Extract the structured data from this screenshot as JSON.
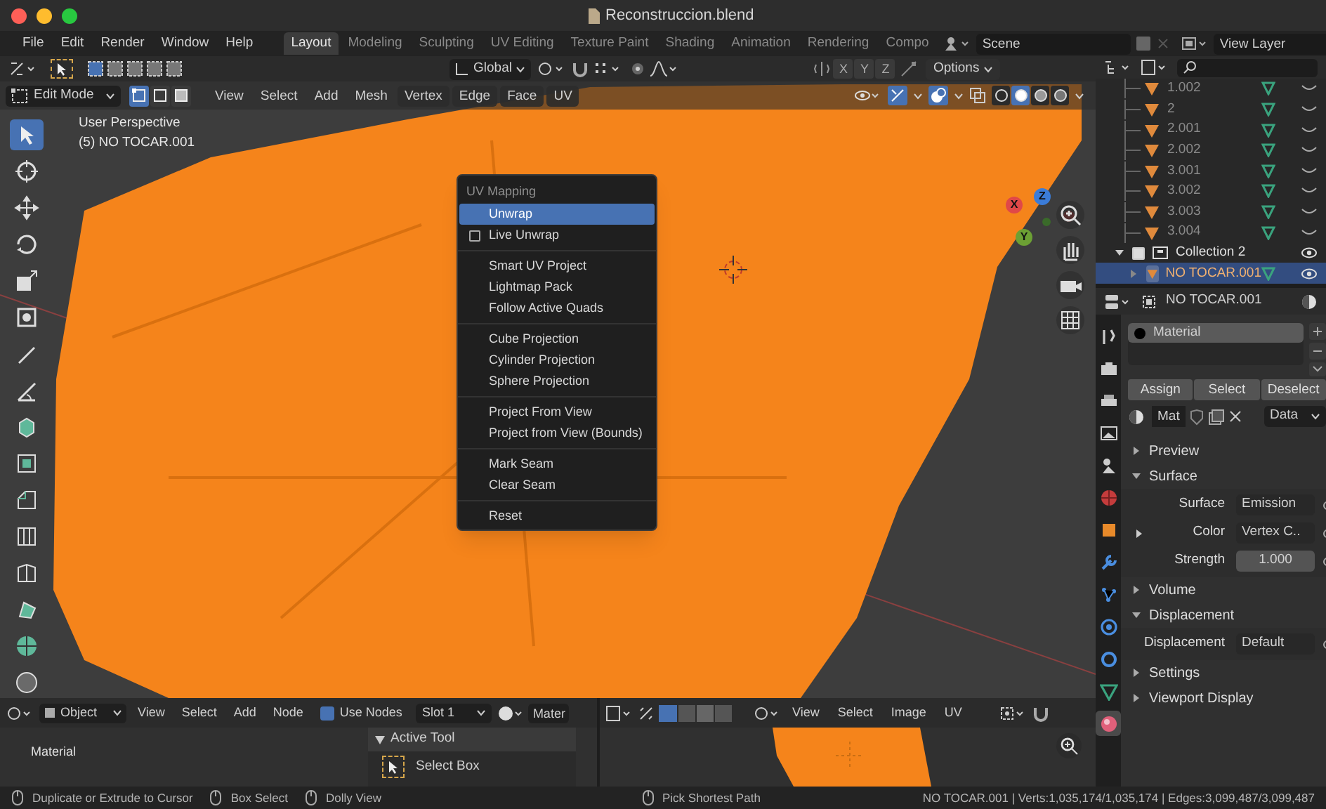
{
  "window": {
    "title": "Reconstruccion.blend"
  },
  "menu": [
    "File",
    "Edit",
    "Render",
    "Window",
    "Help"
  ],
  "workspaces": [
    {
      "label": "Layout",
      "selected": true
    },
    {
      "label": "Modeling",
      "selected": false
    },
    {
      "label": "Sculpting",
      "selected": false
    },
    {
      "label": "UV Editing",
      "selected": false
    },
    {
      "label": "Texture Paint",
      "selected": false
    },
    {
      "label": "Shading",
      "selected": false
    },
    {
      "label": "Animation",
      "selected": false
    },
    {
      "label": "Rendering",
      "selected": false
    },
    {
      "label": "Compo",
      "selected": false
    }
  ],
  "scene": "Scene",
  "view_layer": "View Layer",
  "tool_header": {
    "orientation": "Global",
    "axes": [
      "X",
      "Y",
      "Z"
    ],
    "options": "Options"
  },
  "mode_header": {
    "mode": "Edit Mode",
    "select_modes": [
      {
        "selected": true
      },
      {
        "selected": false
      },
      {
        "selected": false
      }
    ],
    "menus": [
      "View",
      "Select",
      "Add",
      "Mesh",
      "Vertex",
      "Edge",
      "Face",
      "UV"
    ],
    "shading": [
      {
        "selected": false
      },
      {
        "selected": true
      },
      {
        "selected": false
      },
      {
        "selected": false
      }
    ]
  },
  "toolbar": [
    {
      "selected": true
    },
    {
      "selected": false
    },
    {
      "selected": false
    },
    {
      "selected": false
    },
    {
      "selected": false
    },
    {
      "selected": false
    },
    {
      "selected": false
    },
    {
      "selected": false
    },
    {
      "selected": false
    },
    {
      "selected": false
    },
    {
      "selected": false
    },
    {
      "selected": false
    },
    {
      "selected": false
    },
    {
      "selected": false
    },
    {
      "selected": false
    },
    {
      "selected": false
    }
  ],
  "viewport": {
    "view_name": "User Perspective",
    "object": "(5) NO TOCAR.001",
    "gizmo_axes": [
      "X",
      "Z",
      "Y"
    ]
  },
  "uv_menu": {
    "title": "UV Mapping",
    "groups": [
      [
        {
          "label": "Unwrap",
          "kind": "item",
          "selected": true
        },
        {
          "label": "Live Unwrap",
          "kind": "checkbox",
          "checked": false,
          "selected": false
        }
      ],
      [
        {
          "label": "Smart UV Project",
          "kind": "item",
          "selected": false
        },
        {
          "label": "Lightmap Pack",
          "kind": "item",
          "selected": false
        },
        {
          "label": "Follow Active Quads",
          "kind": "item",
          "selected": false
        }
      ],
      [
        {
          "label": "Cube Projection",
          "kind": "item",
          "selected": false
        },
        {
          "label": "Cylinder Projection",
          "kind": "item",
          "selected": false
        },
        {
          "label": "Sphere Projection",
          "kind": "item",
          "selected": false
        }
      ],
      [
        {
          "label": "Project From View",
          "kind": "item",
          "selected": false
        },
        {
          "label": "Project from View (Bounds)",
          "kind": "item",
          "selected": false
        }
      ],
      [
        {
          "label": "Mark Seam",
          "kind": "item",
          "selected": false
        },
        {
          "label": "Clear Seam",
          "kind": "item",
          "selected": false
        }
      ],
      [
        {
          "label": "Reset",
          "kind": "item",
          "selected": false
        }
      ]
    ]
  },
  "outliner": {
    "items": [
      {
        "label": "1.002",
        "kind": "mesh",
        "visible": false,
        "selected": false
      },
      {
        "label": "2",
        "kind": "mesh",
        "visible": false,
        "selected": false
      },
      {
        "label": "2.001",
        "kind": "mesh",
        "visible": false,
        "selected": false
      },
      {
        "label": "2.002",
        "kind": "mesh",
        "visible": false,
        "selected": false
      },
      {
        "label": "3.001",
        "kind": "mesh",
        "visible": false,
        "selected": false
      },
      {
        "label": "3.002",
        "kind": "mesh",
        "visible": false,
        "selected": false
      },
      {
        "label": "3.003",
        "kind": "mesh",
        "visible": false,
        "selected": false
      },
      {
        "label": "3.004",
        "kind": "mesh",
        "visible": false,
        "selected": false
      },
      {
        "label": "Collection 2",
        "kind": "collection",
        "visible": true,
        "checked": true,
        "expanded": true,
        "selected": false,
        "children": [
          {
            "label": "NO TOCAR.001",
            "kind": "mesh",
            "visible": true,
            "selected": true
          }
        ]
      }
    ]
  },
  "properties": {
    "object": "NO TOCAR.001",
    "tabs": [
      {
        "selected": false
      },
      {
        "selected": false
      },
      {
        "selected": false
      },
      {
        "selected": false
      },
      {
        "selected": false
      },
      {
        "selected": false
      },
      {
        "selected": false
      },
      {
        "selected": false
      },
      {
        "selected": false
      },
      {
        "selected": false
      },
      {
        "selected": false
      },
      {
        "selected": false
      },
      {
        "selected": true
      }
    ],
    "material_slots": [
      {
        "label": "Material",
        "selected": true
      }
    ],
    "buttons": [
      "Assign",
      "Select",
      "Deselect"
    ],
    "material_name": "Mat",
    "link": "Data",
    "panels": [
      {
        "label": "Preview",
        "expanded": false
      },
      {
        "label": "Surface",
        "expanded": true,
        "fields": [
          {
            "label": "Surface",
            "value": "Emission",
            "kind": "menu"
          },
          {
            "label": "Color",
            "value": "Vertex C..",
            "kind": "menu",
            "expandable": true
          },
          {
            "label": "Strength",
            "value": "1.000",
            "kind": "number"
          }
        ]
      },
      {
        "label": "Volume",
        "expanded": false
      },
      {
        "label": "Displacement",
        "expanded": true,
        "fields": [
          {
            "label": "Displacement",
            "value": "Default",
            "kind": "menu"
          }
        ]
      },
      {
        "label": "Settings",
        "expanded": false
      },
      {
        "label": "Viewport Display",
        "expanded": false
      }
    ]
  },
  "shader_editor": {
    "object_type": "Object",
    "menus": [
      "View",
      "Select",
      "Add",
      "Node"
    ],
    "use_nodes": {
      "label": "Use Nodes",
      "checked": true
    },
    "slot": "Slot 1",
    "material": "Mater",
    "node_label": "Material",
    "sidebar": {
      "panel": "Active Tool",
      "tool": "Select Box"
    }
  },
  "uv_editor": {
    "menus": [
      "View",
      "Select",
      "Image",
      "UV"
    ]
  },
  "status_bar": {
    "hints": [
      "Duplicate or Extrude to Cursor",
      "Box Select",
      "Dolly View",
      "Pick Shortest Path"
    ],
    "stats": "NO TOCAR.001 | Verts:1,035,174/1,035,174 | Edges:3,099,487/3,099,487"
  }
}
